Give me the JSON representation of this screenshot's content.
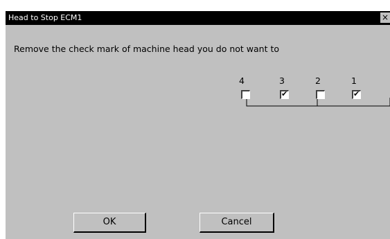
{
  "window": {
    "title": "Head to Stop ECM1",
    "close_glyph": "×"
  },
  "instruction": "Remove the check mark of machine head you do not want to",
  "heads": [
    {
      "label": "4",
      "checked": false
    },
    {
      "label": "3",
      "checked": true
    },
    {
      "label": "2",
      "checked": false
    },
    {
      "label": "1",
      "checked": true
    }
  ],
  "buttons": {
    "ok_label": "OK",
    "cancel_label": "Cancel"
  },
  "colors": {
    "dialog_bg": "#c0c0c0",
    "titlebar_bg": "#000000",
    "titlebar_text": "#ffffff"
  }
}
